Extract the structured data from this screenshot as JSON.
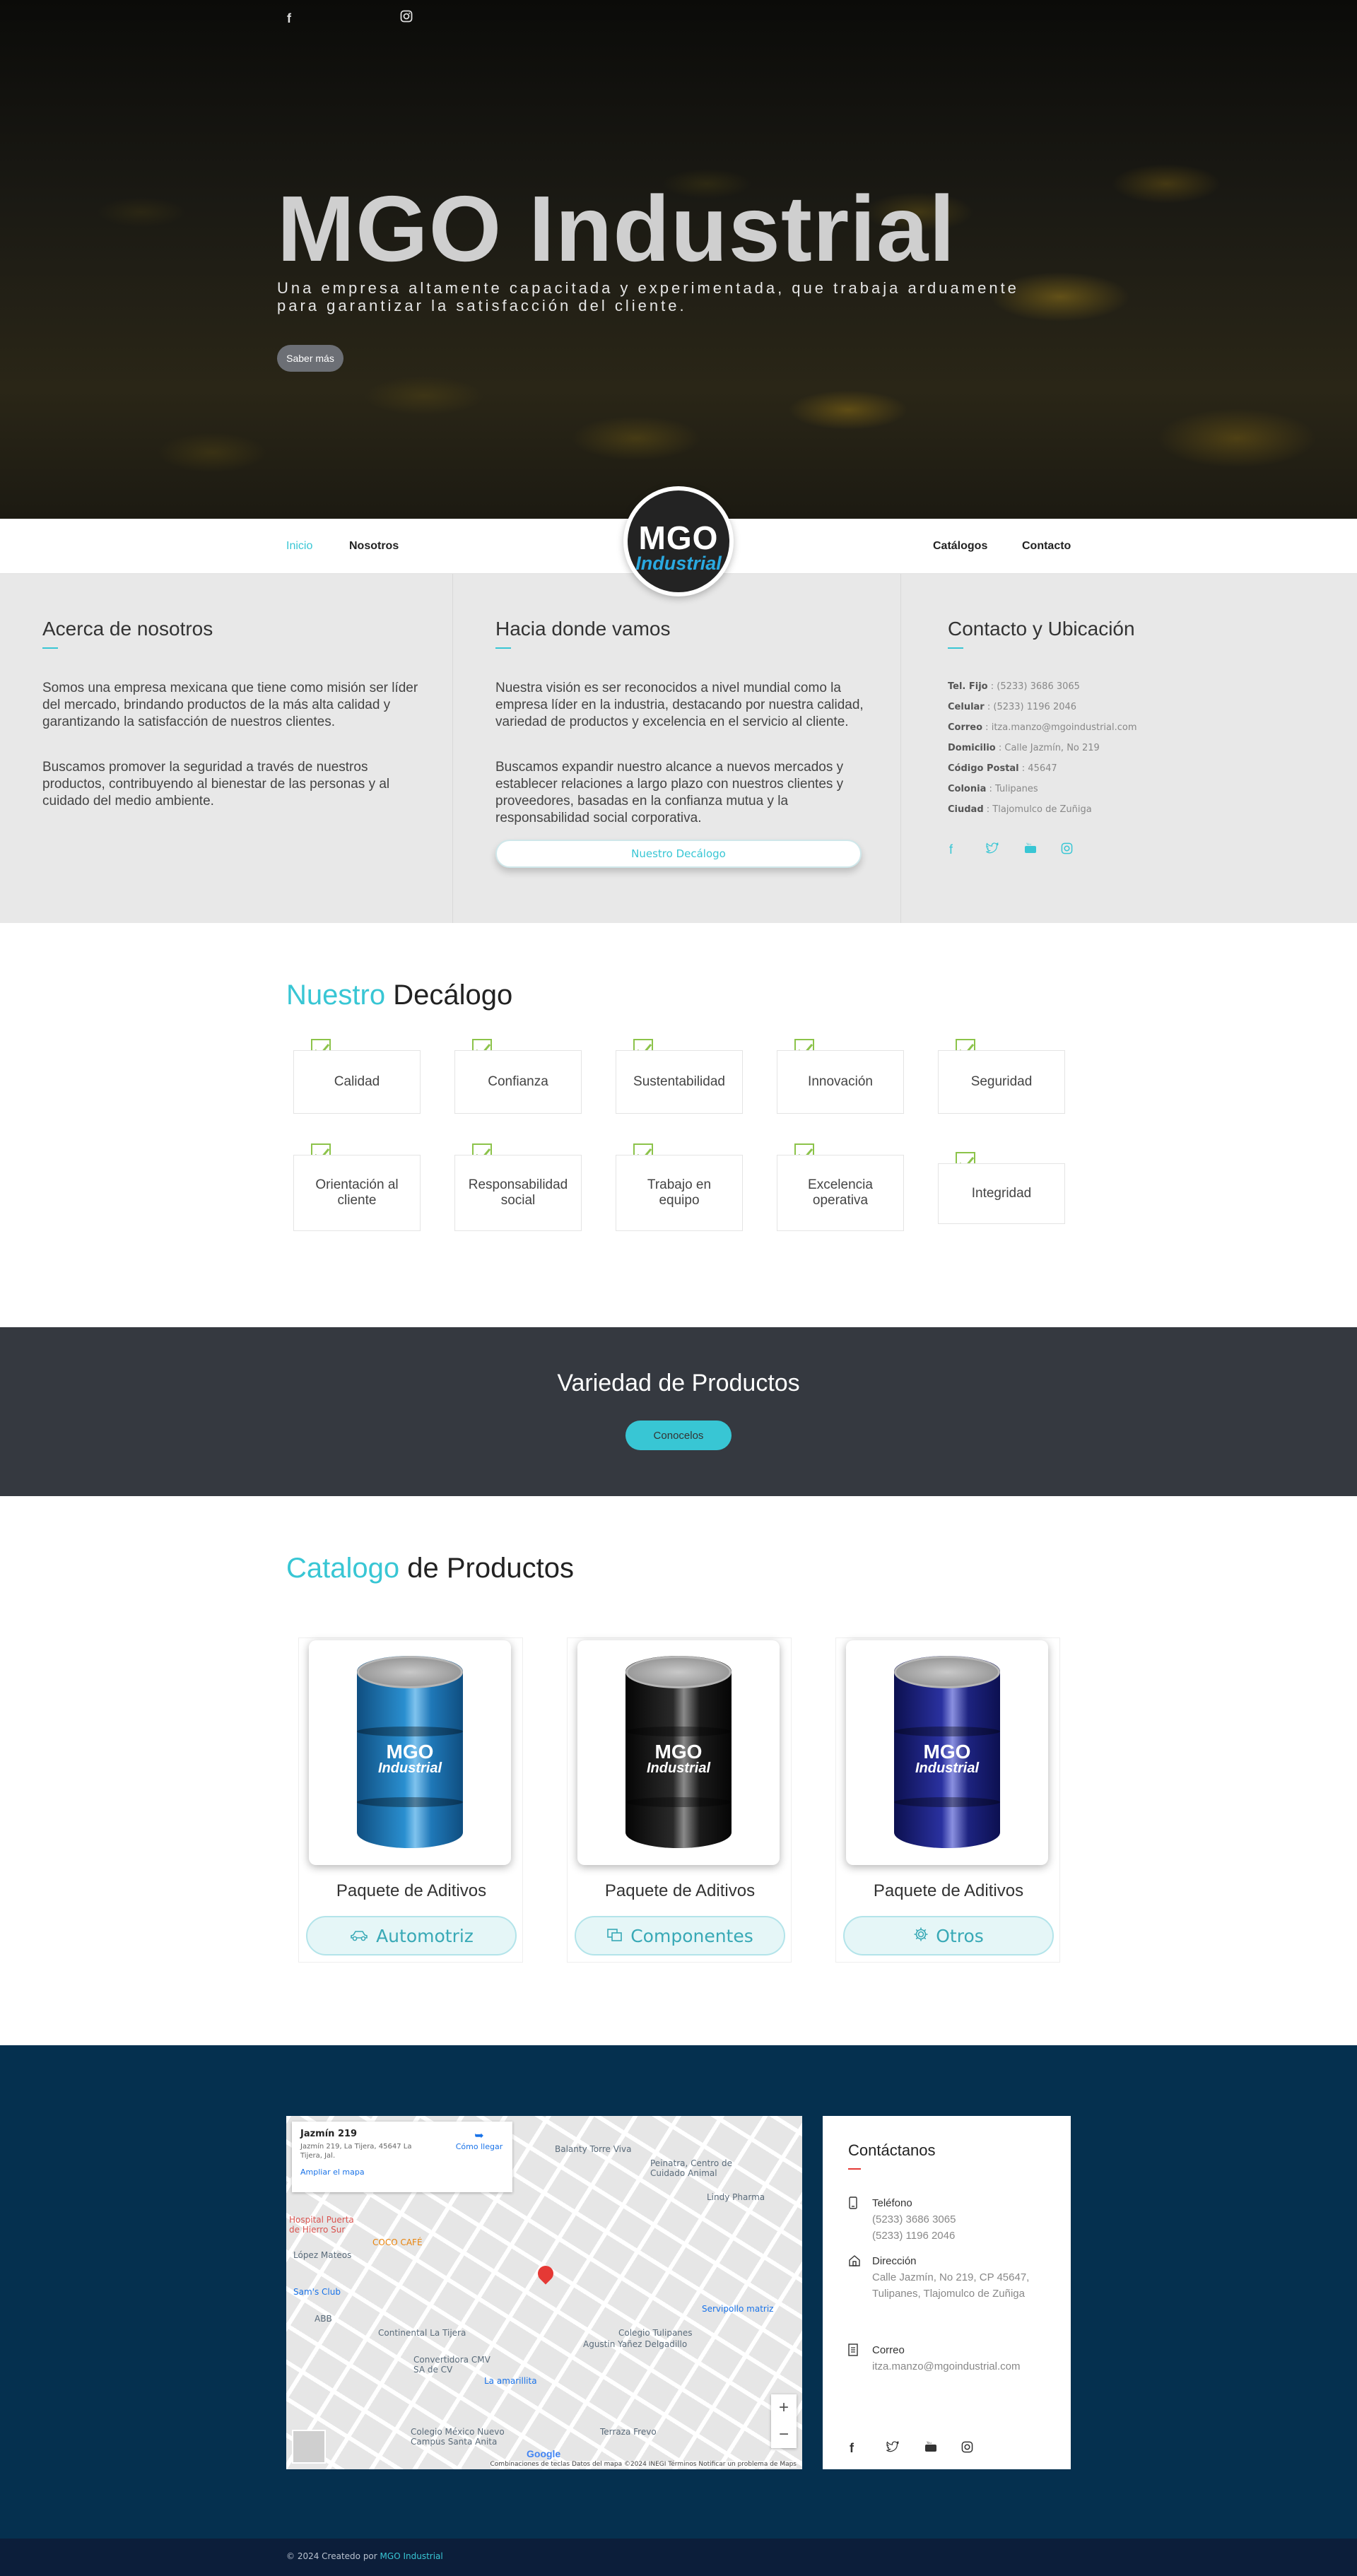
{
  "hero": {
    "social_icons": [
      "facebook-icon",
      "instagram-icon"
    ],
    "title": "MGO Industrial",
    "subtitle": "Una empresa altamente capacitada y experimentada, que trabaja arduamente para garantizar la satisfacción del cliente.",
    "cta_label": "Saber más"
  },
  "nav": {
    "left": [
      "Inicio",
      "Nosotros"
    ],
    "right": [
      "Catálogos",
      "Contacto"
    ],
    "logo_top": "MGO",
    "logo_bottom": "Industrial"
  },
  "about": {
    "col1": {
      "title": "Acerca de nosotros",
      "p1": "Somos una empresa mexicana que tiene como misión ser líder del mercado, brindando productos de la más alta calidad y garantizando la satisfacción de nuestros clientes.",
      "p2": "Buscamos promover la seguridad a través de nuestros productos, contribuyendo al bienestar de las personas y al cuidado del medio ambiente."
    },
    "col2": {
      "title": "Hacia donde vamos",
      "p1": "Nuestra visión es ser reconocidos a nivel mundial como la empresa líder en la industria, destacando por nuestra calidad, variedad de productos y excelencia en el servicio al cliente.",
      "p2": "Buscamos expandir nuestro alcance a nuevos mercados y establecer relaciones a largo plazo con nuestros clientes y proveedores, basadas en la confianza mutua y la responsabilidad social corporativa.",
      "button": "Nuestro Decálogo"
    },
    "col3": {
      "title": "Contacto y Ubicación",
      "lines": [
        {
          "label": "Tel. Fijo",
          "value": "(5233) 3686 3065"
        },
        {
          "label": "Celular",
          "value": "(5233) 1196 2046"
        },
        {
          "label": "Correo",
          "value": "itza.manzo@mgoindustrial.com"
        },
        {
          "label": "Domicilio",
          "value": "Calle Jazmín, No 219"
        },
        {
          "label": "Código Postal",
          "value": "45647"
        },
        {
          "label": "Colonia",
          "value": "Tulipanes"
        },
        {
          "label": "Ciudad",
          "value": "Tlajomulco de Zuñiga"
        }
      ],
      "social_icons": [
        "facebook-icon",
        "twitter-icon",
        "youtube-icon",
        "instagram-icon"
      ]
    }
  },
  "decalogo": {
    "title_hl": "Nuestro",
    "title_rest": "Decálogo",
    "values": [
      "Calidad",
      "Confianza",
      "Sustentabilidad",
      "Innovación",
      "Seguridad",
      "Orientación al cliente",
      "Responsabilidad social",
      "Trabajo en equipo",
      "Excelencia operativa",
      "Integridad"
    ]
  },
  "banner": {
    "title": "Variedad de Productos",
    "button": "Conocelos"
  },
  "catalog": {
    "title_hl": "Catalogo",
    "title_rest": "de Productos",
    "products": [
      {
        "name": "Paquete de Aditivos",
        "button": "Automotriz",
        "icon": "car-icon",
        "barrel_color": "#1f78b8"
      },
      {
        "name": "Paquete de Aditivos",
        "button": "Componentes",
        "icon": "components-icon",
        "barrel_color": "#1b1b1b"
      },
      {
        "name": "Paquete de Aditivos",
        "button": "Otros",
        "icon": "gear-icon",
        "barrel_color": "#1d2380"
      }
    ],
    "barrel_brand_top": "MGO",
    "barrel_brand_bottom": "Industrial"
  },
  "map": {
    "place_title": "Jazmín 219",
    "place_address": "Jazmín 219, La Tijera, 45647 La Tijera, Jal.",
    "enlarge_link": "Ampliar el mapa",
    "directions": "Cómo llegar",
    "labels": {
      "balanty": "Balanty Torre Viva",
      "lindy": "Lindy Pharma",
      "coco": "COCO CAFÉ",
      "lopez": "López Mateos",
      "sams": "Sam's Club",
      "continental": "Continental La Tijera",
      "convertidora": "Convertidora CMV SA de CV",
      "colegio": "Colegio Tulipanes",
      "agustin": "Agustin Yañez Delgadillo",
      "amarillita": "La amarillita",
      "servipollo": "Servipollo matriz",
      "colegio_mx": "Colegio México Nuevo Campus Santa Anita",
      "terraza": "Terraza Frevo",
      "hospital": "Hospital Puerta de Hierro Sur",
      "peinatra": "Peinatra, Centro de Cuidado Animal",
      "abb": "ABB"
    },
    "footer": "Combinaciones de teclas   Datos del mapa ©2024 INEGI   Términos   Notificar un problema de Maps",
    "google": "Google"
  },
  "footer_contact": {
    "title": "Contáctanos",
    "phone_label": "Teléfono",
    "phone1": "(5233) 3686 3065",
    "phone2": "(5233) 1196 2046",
    "addr_label": "Dirección",
    "addr": "Calle Jazmín, No 219, CP 45647, Tulipanes, Tlajomulco de Zuñiga",
    "mail_label": "Correo",
    "mail": "itza.manzo@mgoindustrial.com",
    "social_icons": [
      "facebook-icon",
      "twitter-icon",
      "youtube-icon",
      "instagram-icon"
    ]
  },
  "bottom": {
    "prefix": "© 2024 Createdo por",
    "link": "MGO Industrial"
  }
}
